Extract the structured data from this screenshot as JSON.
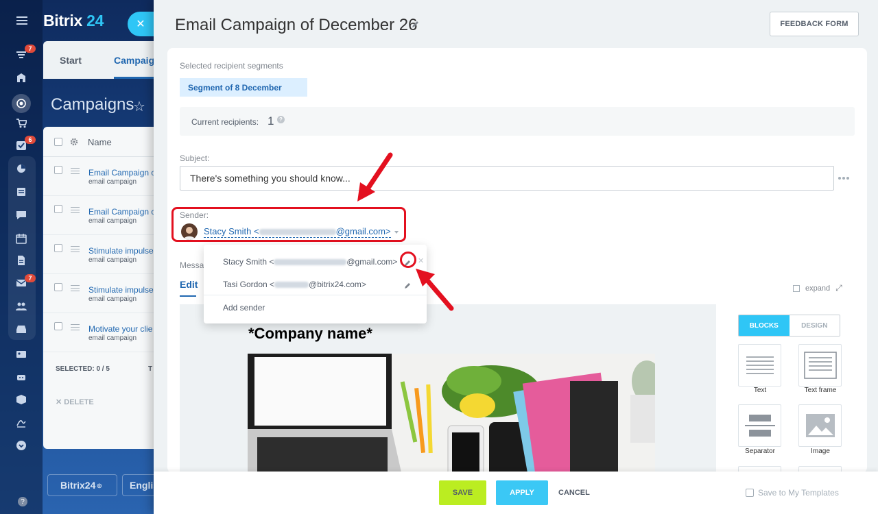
{
  "background_app": {
    "logo_text": "Bitrix",
    "logo_number": "24",
    "tabs": [
      "Start",
      "Campaig"
    ],
    "page_title": "Campaigns",
    "list_header": "Name",
    "rows": [
      {
        "title": "Email Campaign o",
        "subtitle": "email campaign"
      },
      {
        "title": "Email Campaign o",
        "subtitle": "email campaign"
      },
      {
        "title": "Stimulate impulse",
        "subtitle": "email campaign"
      },
      {
        "title": "Stimulate impulse",
        "subtitle": "email campaign"
      },
      {
        "title": "Motivate your clie",
        "subtitle": "email campaign"
      }
    ],
    "selected_text": "SELECTED: 0 / 5",
    "selected_extra": "T",
    "delete_text": "DELETE",
    "footer_buttons": [
      "Bitrix24",
      "Englis"
    ],
    "badges": [
      "7",
      "6",
      "7"
    ],
    "help_glyph": "?"
  },
  "slider": {
    "title": "Email Campaign of December 26",
    "feedback_button": "FEEDBACK FORM",
    "segments_label": "Selected recipient segments",
    "segment_chip": "Segment of 8 December",
    "current_recipients_label": "Current recipients:",
    "current_recipients_value": "1",
    "help_glyph": "?",
    "subject_label": "Subject:",
    "subject_value": "There's something you should know...",
    "sender_label": "Sender:",
    "sender_name": "Stacy Smith <",
    "sender_domain": "@gmail.com>",
    "message_label": "Messa",
    "edit_tab": "Edit",
    "expand_label": "expand",
    "company_name": "*Company name*",
    "blocks_tab": "BLOCKS",
    "design_tab": "DESIGN",
    "blocks": [
      {
        "label": "Text"
      },
      {
        "label": "Text frame"
      },
      {
        "label": "Separator"
      },
      {
        "label": "Image"
      }
    ],
    "footer": {
      "save": "SAVE",
      "apply": "APPLY",
      "cancel": "CANCEL",
      "save_template": "Save to My Templates"
    }
  },
  "sender_dropdown": {
    "items": [
      {
        "name": "Stacy Smith <",
        "domain": "@gmail.com>"
      },
      {
        "name": "Tasi Gordon <",
        "domain": "@bitrix24.com>"
      }
    ],
    "add_sender": "Add sender",
    "close_glyph": "✕"
  },
  "accent_colors": {
    "primary_blue": "#2067b0",
    "cyan": "#2fc6f6",
    "save_green": "#bbed21",
    "highlight_red": "#e3101f"
  }
}
